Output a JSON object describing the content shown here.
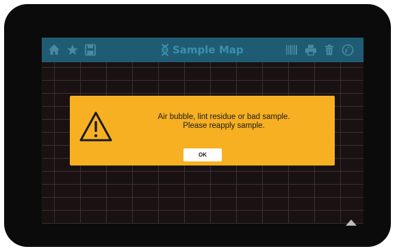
{
  "app": {
    "title": "Sample Map"
  },
  "toolbar": {
    "left_icons": [
      "home-icon",
      "star-icon",
      "save-icon"
    ],
    "title_icon": "dna-icon",
    "right_icons": [
      "barcode-icon",
      "print-icon",
      "trash-icon",
      "info-icon"
    ]
  },
  "dialog": {
    "icon": "warning-icon",
    "message_line1": "Air bubble, lint residue or bad sample.",
    "message_line2": "Please reapply sample.",
    "ok_label": "OK"
  },
  "colors": {
    "toolbar_bg": "#1f5c73",
    "toolbar_title": "#3b8fae",
    "toolbar_icon": "#4a8aa0",
    "dialog_bg": "#f6b022",
    "screen_bg": "#1a1212",
    "bezel": "#0b0b0b"
  }
}
